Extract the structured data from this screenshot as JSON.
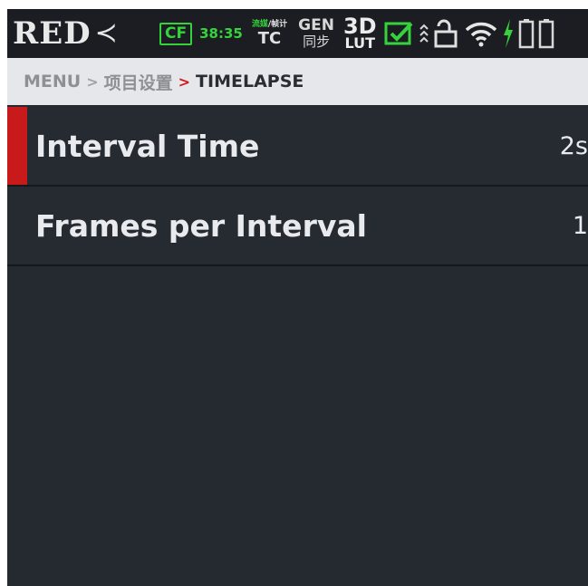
{
  "status_bar": {
    "logo": "RED",
    "logo_chevron": "≺",
    "media_label": "CF",
    "media_time": "38:35",
    "tc_top_left": "流媒",
    "tc_top_sep": "/",
    "tc_top_right": "帧计",
    "tc_label": "TC",
    "gen_label": "GEN",
    "gen_sub": "同步",
    "lut_top": "3D",
    "lut_bottom": "LUT",
    "icons": [
      "checkbox-monitor-icon",
      "up-chevrons-icon",
      "unlock-icon",
      "wifi-icon",
      "charging-bolt-icon",
      "battery-icon",
      "battery-icon"
    ],
    "accent_green": "#35d23c"
  },
  "breadcrumb": {
    "menu": "MENU",
    "sep1": ">",
    "parent": "项目设置",
    "sep2": ">",
    "current": "TIMELAPSE",
    "accent_red": "#d01a1a"
  },
  "menu": {
    "items": [
      {
        "label": "Interval Time",
        "value": "2s",
        "selected": true
      },
      {
        "label": "Frames per Interval",
        "value": "1",
        "selected": false
      }
    ]
  }
}
